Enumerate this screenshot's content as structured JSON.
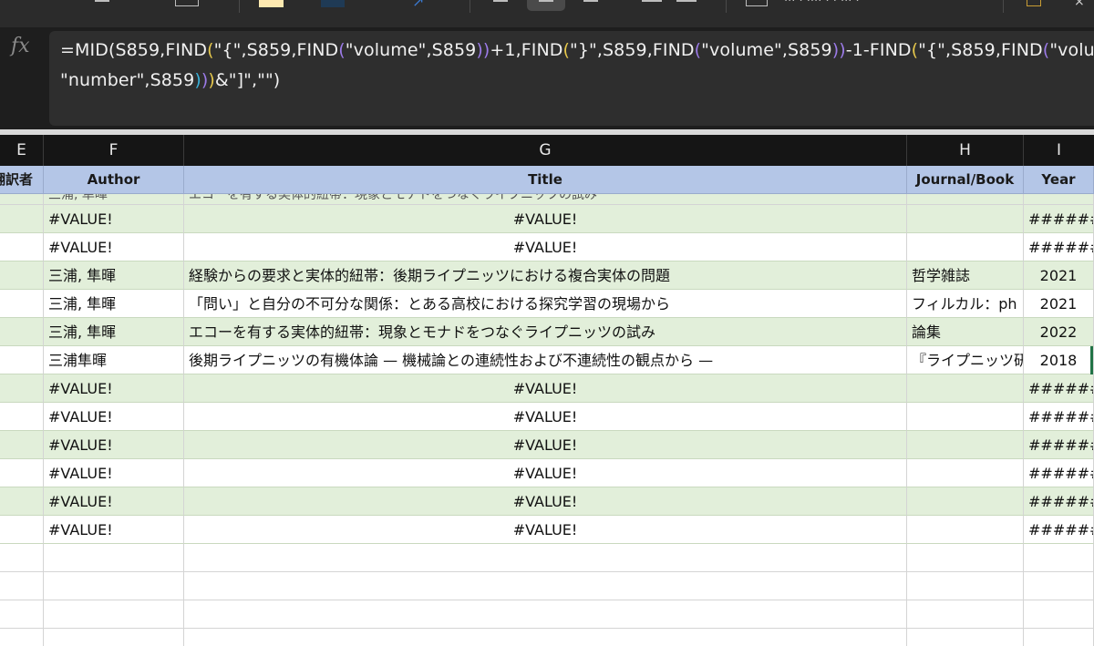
{
  "formula_bar": {
    "icon": "fx-icon",
    "line1": [
      {
        "t": "=MID(S859,FIND",
        "c": "plain"
      },
      {
        "t": "(",
        "c": "yellow"
      },
      {
        "t": "\"{\",S859,FIND",
        "c": "plain"
      },
      {
        "t": "(",
        "c": "purple"
      },
      {
        "t": "\"volume\",S859",
        "c": "plain"
      },
      {
        "t": "))",
        "c": "purple"
      },
      {
        "t": "+1,FIND",
        "c": "plain"
      },
      {
        "t": "(",
        "c": "yellow"
      },
      {
        "t": "\"}\",S859,FIND",
        "c": "plain"
      },
      {
        "t": "(",
        "c": "purple"
      },
      {
        "t": "\"volume\",S859",
        "c": "plain"
      },
      {
        "t": "))",
        "c": "purple"
      },
      {
        "t": "-1-FIND",
        "c": "plain"
      },
      {
        "t": "(",
        "c": "yellow"
      },
      {
        "t": "\"{\",S859,FIND",
        "c": "plain"
      },
      {
        "t": "(",
        "c": "purple"
      },
      {
        "t": "\"volu",
        "c": "plain"
      }
    ],
    "line2": [
      {
        "t": "\"number\",S859",
        "c": "plain"
      },
      {
        "t": ")",
        "c": "cyan"
      },
      {
        "t": ")",
        "c": "purple"
      },
      {
        "t": ")",
        "c": "yellow"
      },
      {
        "t": "&\"]\",\"\")",
        "c": "plain"
      }
    ]
  },
  "columns": [
    "E",
    "F",
    "G",
    "H",
    "I"
  ],
  "header_row": {
    "e": "翻訳者",
    "f": "Author",
    "g": "Title",
    "h": "Journal/Book",
    "i": "Year"
  },
  "partial_row": {
    "f": "三浦, 隼暉",
    "g": "エコーを有する実体的紐帯：現象とモナドをつなぐライプニッツの試み"
  },
  "rows": [
    {
      "style": "green",
      "f": "#VALUE!",
      "g": "#VALUE!",
      "h": "",
      "i": "######"
    },
    {
      "style": "white",
      "f": "#VALUE!",
      "g": "#VALUE!",
      "h": "",
      "i": "######"
    },
    {
      "style": "green",
      "f": "三浦, 隼暉",
      "g": "経験からの要求と実体的紐帯：後期ライプニッツにおける複合実体の問題",
      "h": "哲学雑誌",
      "i": "2021"
    },
    {
      "style": "white",
      "f": "三浦, 隼暉",
      "g": "「問い」と自分の不可分な関係：とある高校における探究学習の現場から",
      "h": "フィルカル：ph",
      "i": "2021"
    },
    {
      "style": "green",
      "f": "三浦, 隼暉",
      "g": "エコーを有する実体的紐帯：現象とモナドをつなぐライプニッツの試み",
      "h": "論集",
      "i": "2022"
    },
    {
      "style": "white",
      "f": "三浦隼暉",
      "g": "後期ライプニッツの有機体論 — 機械論との連続性および不連続性の観点から —",
      "h": "『ライプニッツ研",
      "i": "2018",
      "selected": true
    },
    {
      "style": "green",
      "f": "#VALUE!",
      "g": "#VALUE!",
      "h": "",
      "i": "######"
    },
    {
      "style": "white",
      "f": "#VALUE!",
      "g": "#VALUE!",
      "h": "",
      "i": "######"
    },
    {
      "style": "green",
      "f": "#VALUE!",
      "g": "#VALUE!",
      "h": "",
      "i": "######"
    },
    {
      "style": "white",
      "f": "#VALUE!",
      "g": "#VALUE!",
      "h": "",
      "i": "######"
    },
    {
      "style": "green",
      "f": "#VALUE!",
      "g": "#VALUE!",
      "h": "",
      "i": "######"
    },
    {
      "style": "white",
      "f": "#VALUE!",
      "g": "#VALUE!",
      "h": "",
      "i": "######"
    },
    {
      "style": "empty",
      "f": "",
      "g": "",
      "h": "",
      "i": ""
    },
    {
      "style": "empty",
      "f": "",
      "g": "",
      "h": "",
      "i": ""
    },
    {
      "style": "empty",
      "f": "",
      "g": "",
      "h": "",
      "i": ""
    },
    {
      "style": "empty",
      "f": "",
      "g": "",
      "h": "",
      "i": ""
    }
  ],
  "colors": {
    "header_fill": "#b4c6e7",
    "band_fill": "#e2efda",
    "formula_paren_1": "#e6c84c",
    "formula_paren_2": "#9c7be8",
    "formula_paren_3": "#3ab0d8",
    "selection_edge": "#217346"
  }
}
